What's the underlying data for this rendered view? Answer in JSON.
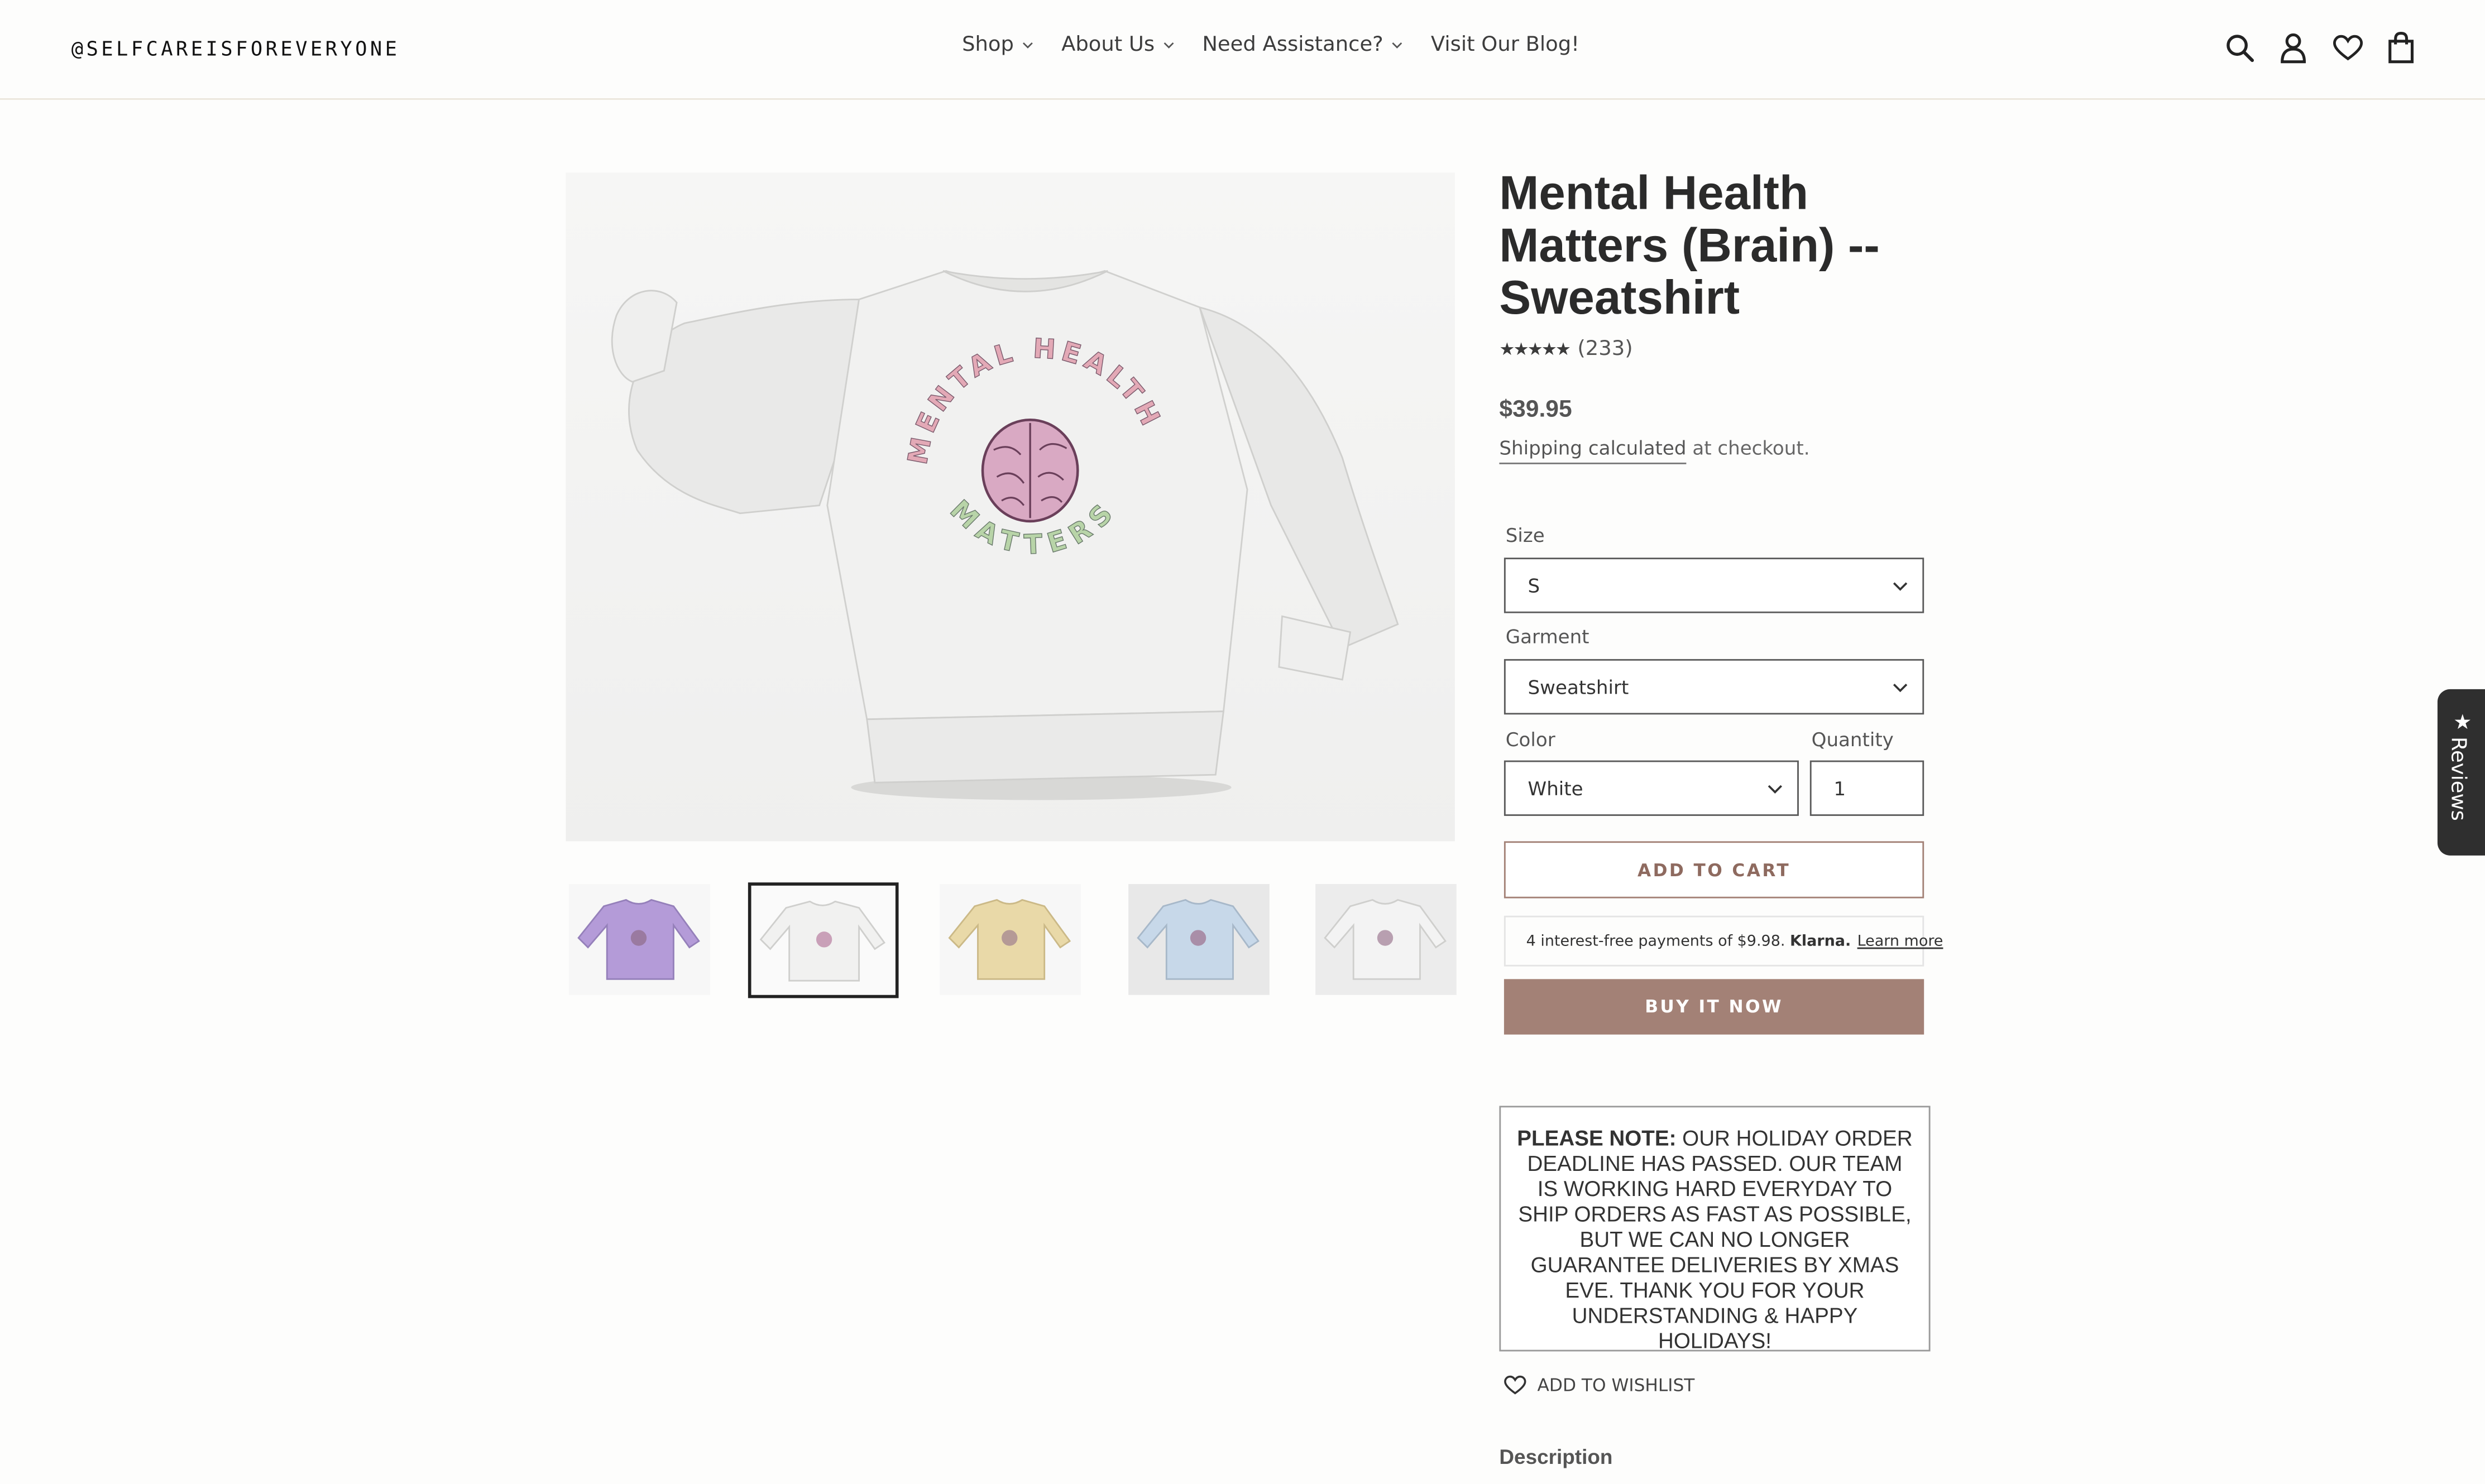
{
  "header": {
    "logo": "@SELFCAREISFOREVERYONE",
    "nav": [
      {
        "label": "Shop",
        "has_dropdown": true
      },
      {
        "label": "About Us",
        "has_dropdown": true
      },
      {
        "label": "Need Assistance?",
        "has_dropdown": true
      },
      {
        "label": "Visit Our Blog!",
        "has_dropdown": false
      }
    ],
    "icons": [
      "search-icon",
      "account-icon",
      "heart-icon",
      "cart-icon"
    ]
  },
  "gallery": {
    "main_image": "white-sweatshirt-mental-health-matters-brain",
    "main_graphic_top_text": "MENTAL HEALTH",
    "main_graphic_bottom_text": "MATTERS",
    "thumbnails": [
      {
        "name": "lavender",
        "color": "#b49bd8",
        "selected": false
      },
      {
        "name": "white",
        "color": "#f4f4f4",
        "selected": true
      },
      {
        "name": "cream",
        "color": "#e9d9a8",
        "selected": false
      },
      {
        "name": "light-blue",
        "color": "#c7d8e9",
        "selected": false
      },
      {
        "name": "light-gray",
        "color": "#e6e6e6",
        "selected": false
      }
    ]
  },
  "product": {
    "title": "Mental Health Matters (Brain) -- Sweatshirt",
    "stars": "★★★★★",
    "review_count": "(233)",
    "price": "$39.95",
    "shipping_link": "Shipping calculated",
    "shipping_rest": " at checkout."
  },
  "options": {
    "size_label": "Size",
    "size_value": "S",
    "garment_label": "Garment",
    "garment_value": "Sweatshirt",
    "color_label": "Color",
    "color_value": "White",
    "quantity_label": "Quantity",
    "quantity_value": "1"
  },
  "actions": {
    "add_to_cart": "ADD TO CART",
    "klarna_text": "4 interest-free payments of $9.98.",
    "klarna_brand": "Klarna.",
    "klarna_link": "Learn more",
    "buy_now": "BUY IT NOW"
  },
  "notice": {
    "bold": "PLEASE NOTE:",
    "text": " OUR HOLIDAY ORDER DEADLINE HAS PASSED. OUR TEAM IS WORKING HARD EVERYDAY TO SHIP ORDERS AS FAST AS POSSIBLE, BUT WE CAN NO LONGER GUARANTEE DELIVERIES BY XMAS EVE. THANK YOU FOR YOUR UNDERSTANDING & HAPPY HOLIDAYS!"
  },
  "wishlist_label": "ADD TO WISHLIST",
  "description_label": "Description",
  "reviews_tab": "Reviews",
  "colors": {
    "accent": "#a38176",
    "accent_text": "#8e6a5f",
    "reviews_tab": "#2f2f2f"
  }
}
